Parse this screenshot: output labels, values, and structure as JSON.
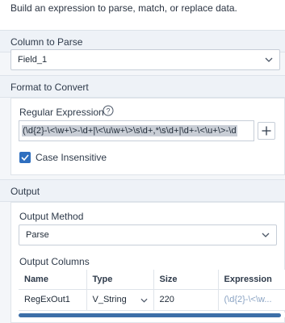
{
  "description": "Build an expression to parse, match, or replace data.",
  "column_to_parse": {
    "heading": "Column to Parse",
    "selected": "Field_1"
  },
  "format_to_convert": {
    "heading": "Format to Convert",
    "regex_label": "Regular Expression",
    "regex_value": "(\\d{2}-\\<\\w+\\>-\\d+|\\<\\u\\w+\\>\\s\\d+,*\\s\\d+|\\d+-\\<\\u+\\>-\\d",
    "case_insensitive_label": "Case Insensitive",
    "case_insensitive_checked": true
  },
  "output": {
    "heading": "Output",
    "method_label": "Output Method",
    "method_selected": "Parse",
    "columns_label": "Output Columns",
    "columns": {
      "headers": [
        "Name",
        "Type",
        "Size",
        "Expression"
      ],
      "rows": [
        {
          "name": "RegExOut1",
          "type": "V_String",
          "size": "220",
          "expression": "(\\d{2}-\\<\\w..."
        }
      ]
    }
  },
  "colors": {
    "accent": "#2f6fbf",
    "section_bg": "#eef2f7",
    "scroll_thumb": "#3d6fa8"
  }
}
